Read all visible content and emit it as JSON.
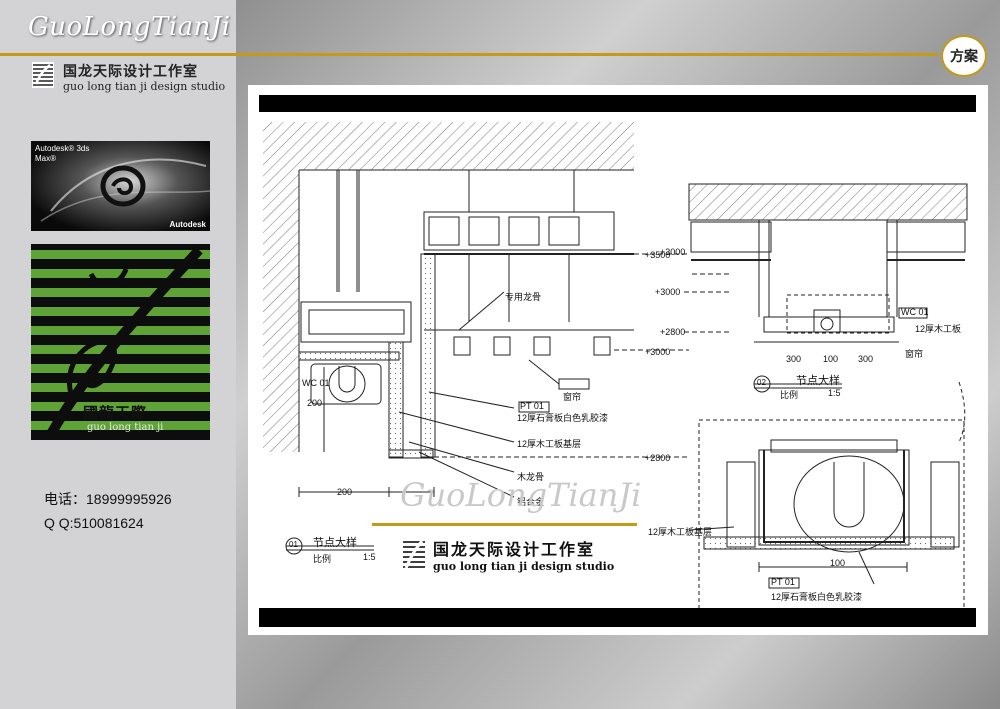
{
  "brand": {
    "script": "GuoLongTianJi",
    "studio_cn": "国龙天际设计工作室",
    "studio_en": "guo long tian ji design studio"
  },
  "autodesk_card": {
    "product": "Autodesk® 3ds Max®",
    "vendor": "Autodesk"
  },
  "logo_card": {
    "cn": "國龍天際",
    "en": "guo long tian ji"
  },
  "contact": {
    "phone": "电话：18999995926",
    "qq": "Q  Q:510081624"
  },
  "badge": "方案",
  "drawing": {
    "detail1_title": "节点大样",
    "detail1_num": "01",
    "detail1_scale_label": "比例",
    "detail1_scale": "1:5",
    "detail2_title": "节点大样",
    "detail2_num": "02",
    "detail2_scale_label": "比例",
    "detail2_scale": "1:5",
    "levels": [
      "+3500",
      "+3000",
      "+3000",
      "+2800",
      "+2800",
      "+3000",
      "+3000"
    ],
    "dims": [
      "200",
      "200",
      "300",
      "100",
      "300",
      "100"
    ],
    "notes": [
      "专用龙骨",
      "窗帘",
      "12厚石膏板白色乳胶漆",
      "12厚木工板基层",
      "木龙骨",
      "铝合金",
      "12厚木工板",
      "窗帘",
      "12厚石膏板白色乳胶漆",
      "12厚木工板基层"
    ],
    "tags": [
      "WC 01",
      "PT 01",
      "WC 01",
      "PT 01"
    ]
  },
  "stamp": {
    "script": "GuoLongTianJi",
    "cn": "国龙天际设计工作室",
    "en": "guo long tian ji design studio"
  }
}
